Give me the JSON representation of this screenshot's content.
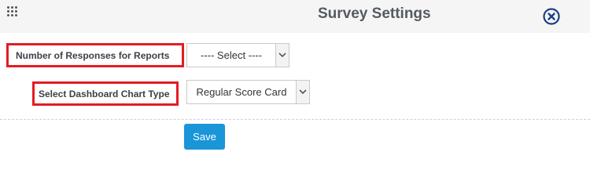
{
  "dialog": {
    "title": "Survey Settings",
    "drag_icon": "drag-handle-icon",
    "close_icon": "close-circle-icon"
  },
  "fields": {
    "responses": {
      "label": "Number of Responses for Reports",
      "selected": "---- Select ----"
    },
    "chart_type": {
      "label": "Select Dashboard Chart Type",
      "selected": "Regular Score Card"
    }
  },
  "actions": {
    "save_label": "Save"
  },
  "colors": {
    "highlight_border": "#e41b23",
    "primary_button": "#1a95d8",
    "close_icon": "#1b3f86"
  }
}
